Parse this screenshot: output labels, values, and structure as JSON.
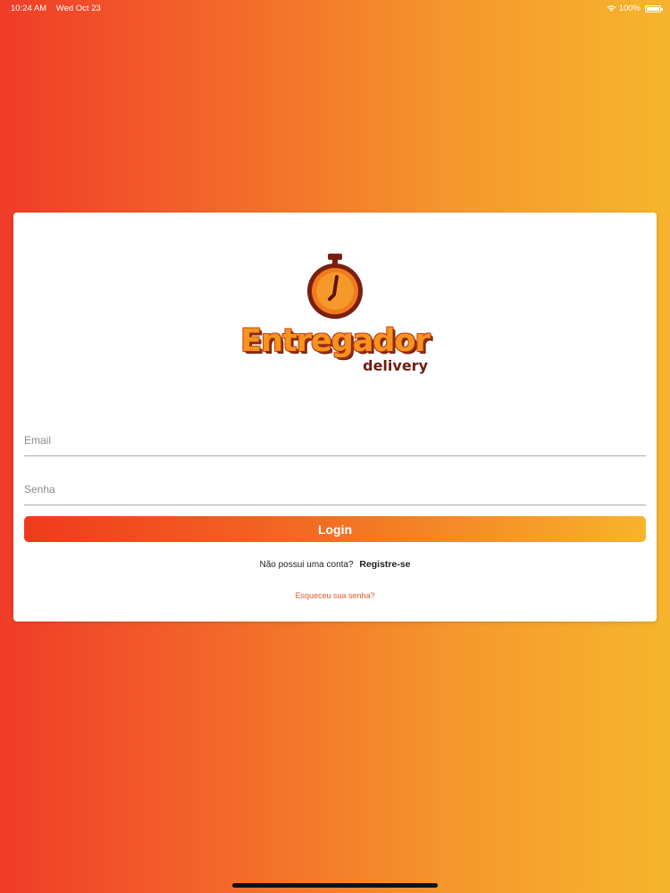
{
  "status_bar": {
    "time": "10:24 AM",
    "date": "Wed Oct 23",
    "battery": "100%",
    "battery_level": 1.0
  },
  "logo": {
    "title": "Entregador",
    "subtitle": "delivery",
    "icon": "stopwatch-icon",
    "colors": {
      "primary": "#f7941d",
      "dark": "#8b2312",
      "accent": "#d94418"
    }
  },
  "form": {
    "email_placeholder": "Email",
    "password_placeholder": "Senha",
    "login_label": "Login"
  },
  "register": {
    "question": "Não possui uma conta?",
    "link": "Registre-se"
  },
  "forgot": {
    "link": "Esqueceu sua senha?"
  },
  "colors": {
    "gradient_start": "#f03c28",
    "gradient_end": "#f6b52c",
    "link_accent": "#e8572a"
  }
}
